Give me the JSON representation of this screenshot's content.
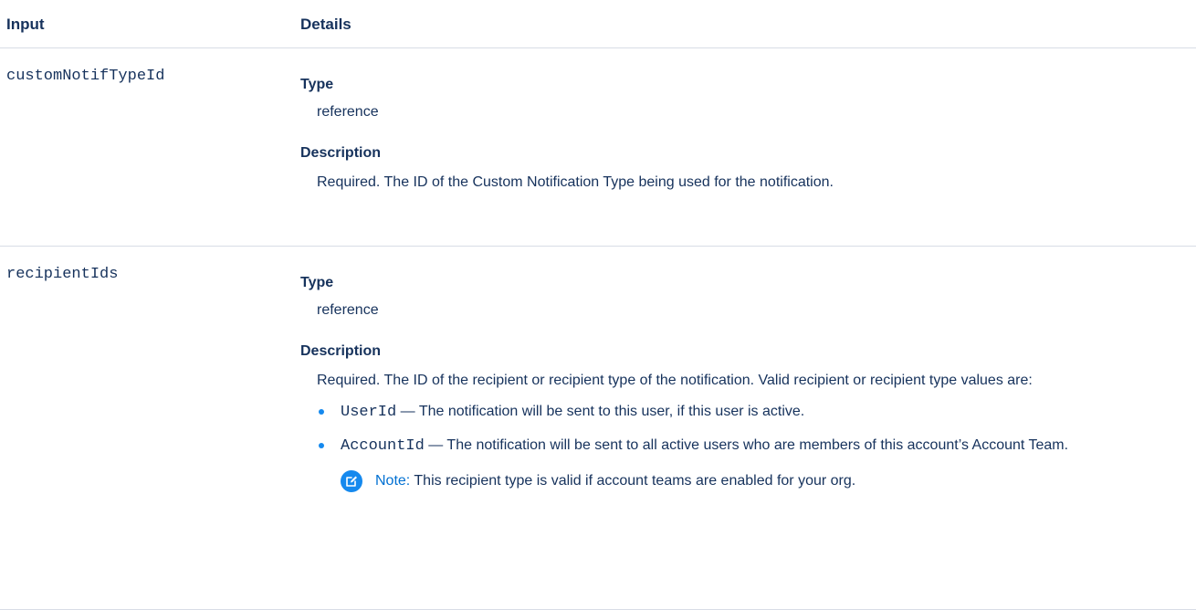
{
  "header": {
    "input": "Input",
    "details": "Details"
  },
  "rows": [
    {
      "param": "customNotifTypeId",
      "type_label": "Type",
      "type_value": "reference",
      "description_label": "Description",
      "description": "Required. The ID of the Custom Notification Type being used for the notification."
    },
    {
      "param": "recipientIds",
      "type_label": "Type",
      "type_value": "reference",
      "description_label": "Description",
      "description": "Required. The ID of the recipient or recipient type of the notification. Valid recipient or recipient type values are:",
      "bullets": [
        {
          "code": "UserId",
          "text": " — The notification will be sent to this user, if this user is active."
        },
        {
          "code": "AccountId",
          "text": " — The notification will be sent to all active users who are members of this account’s Account Team."
        }
      ],
      "note_label": "Note:",
      "note_text": "This recipient type is valid if account teams are enabled for your org."
    }
  ],
  "icons": {
    "note": "edit-note-icon"
  },
  "colors": {
    "text": "#16325c",
    "accent": "#1589ee",
    "note_label": "#0070d2",
    "divider": "#d8dde6"
  }
}
